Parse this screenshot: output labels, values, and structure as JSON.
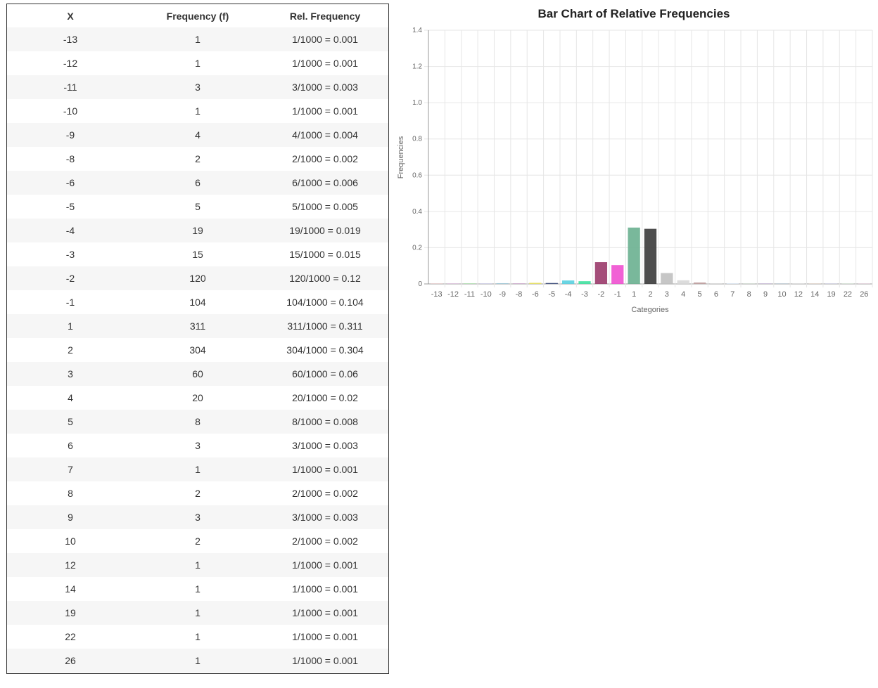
{
  "table": {
    "headers": [
      "X",
      "Frequency (f)",
      "Rel. Frequency"
    ],
    "rows": [
      [
        "-13",
        "1",
        "1/1000 = 0.001"
      ],
      [
        "-12",
        "1",
        "1/1000 = 0.001"
      ],
      [
        "-11",
        "3",
        "3/1000 = 0.003"
      ],
      [
        "-10",
        "1",
        "1/1000 = 0.001"
      ],
      [
        "-9",
        "4",
        "4/1000 = 0.004"
      ],
      [
        "-8",
        "2",
        "2/1000 = 0.002"
      ],
      [
        "-6",
        "6",
        "6/1000 = 0.006"
      ],
      [
        "-5",
        "5",
        "5/1000 = 0.005"
      ],
      [
        "-4",
        "19",
        "19/1000 = 0.019"
      ],
      [
        "-3",
        "15",
        "15/1000 = 0.015"
      ],
      [
        "-2",
        "120",
        "120/1000 = 0.12"
      ],
      [
        "-1",
        "104",
        "104/1000 = 0.104"
      ],
      [
        "1",
        "311",
        "311/1000 = 0.311"
      ],
      [
        "2",
        "304",
        "304/1000 = 0.304"
      ],
      [
        "3",
        "60",
        "60/1000 = 0.06"
      ],
      [
        "4",
        "20",
        "20/1000 = 0.02"
      ],
      [
        "5",
        "8",
        "8/1000 = 0.008"
      ],
      [
        "6",
        "3",
        "3/1000 = 0.003"
      ],
      [
        "7",
        "1",
        "1/1000 = 0.001"
      ],
      [
        "8",
        "2",
        "2/1000 = 0.002"
      ],
      [
        "9",
        "3",
        "3/1000 = 0.003"
      ],
      [
        "10",
        "2",
        "2/1000 = 0.002"
      ],
      [
        "12",
        "1",
        "1/1000 = 0.001"
      ],
      [
        "14",
        "1",
        "1/1000 = 0.001"
      ],
      [
        "19",
        "1",
        "1/1000 = 0.001"
      ],
      [
        "22",
        "1",
        "1/1000 = 0.001"
      ],
      [
        "26",
        "1",
        "1/1000 = 0.001"
      ]
    ]
  },
  "chart_data": {
    "type": "bar",
    "title": "Bar Chart of Relative Frequencies",
    "xlabel": "Categories",
    "ylabel": "Frequencies",
    "ylim": [
      0,
      1.4
    ],
    "yticks": [
      "0",
      "0.2",
      "0.4",
      "0.6",
      "0.8",
      "1.0",
      "1.2",
      "1.4"
    ],
    "grid": true,
    "categories": [
      "-13",
      "-12",
      "-11",
      "-10",
      "-9",
      "-8",
      "-6",
      "-5",
      "-4",
      "-3",
      "-2",
      "-1",
      "1",
      "2",
      "3",
      "4",
      "5",
      "6",
      "7",
      "8",
      "9",
      "10",
      "12",
      "14",
      "19",
      "22",
      "26"
    ],
    "values": [
      0.001,
      0.001,
      0.003,
      0.001,
      0.004,
      0.002,
      0.006,
      0.005,
      0.019,
      0.015,
      0.12,
      0.104,
      0.311,
      0.304,
      0.06,
      0.02,
      0.008,
      0.003,
      0.001,
      0.002,
      0.003,
      0.002,
      0.001,
      0.001,
      0.001,
      0.001,
      0.001
    ],
    "colors": [
      "#d8b0b0",
      "#c9a0c9",
      "#a0d8a0",
      "#b0b0d8",
      "#a0c8d8",
      "#b07ab0",
      "#e8e060",
      "#3a4a7a",
      "#5ad0e0",
      "#40e0a0",
      "#9a3a6a",
      "#f050d0",
      "#6ab090",
      "#3a3a3a",
      "#c0c0c0",
      "#d8d8d8",
      "#c0a0a0",
      "#d0d0d0",
      "#c8d8e8",
      "#b8c8b8",
      "#c0b0d0",
      "#a0b0c0",
      "#c8c8c8",
      "#d0c0b0",
      "#b8b8d0",
      "#c0d0c0",
      "#d0b8c8"
    ]
  }
}
